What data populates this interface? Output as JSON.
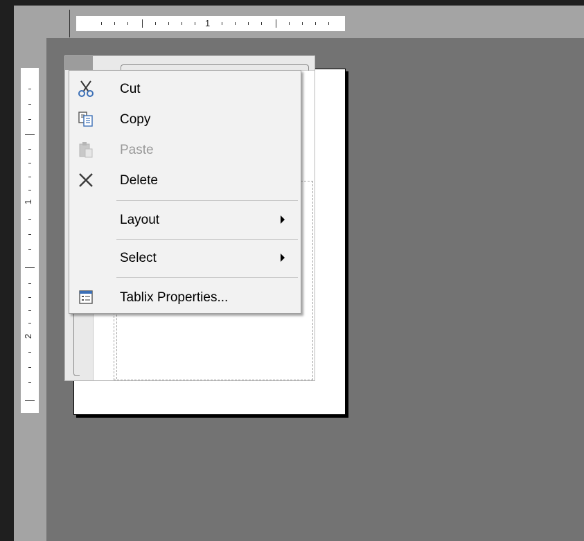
{
  "ruler": {
    "horizontal_number": "1",
    "vertical_numbers": [
      "1",
      "2"
    ]
  },
  "context_menu": {
    "items": [
      {
        "label": "Cut",
        "icon": "scissors-icon",
        "enabled": true
      },
      {
        "label": "Copy",
        "icon": "copy-icon",
        "enabled": true
      },
      {
        "label": "Paste",
        "icon": "paste-icon",
        "enabled": false
      },
      {
        "label": "Delete",
        "icon": "delete-x-icon",
        "enabled": true
      },
      {
        "label": "Layout",
        "icon": "",
        "enabled": true,
        "submenu": true
      },
      {
        "label": "Select",
        "icon": "",
        "enabled": true,
        "submenu": true
      },
      {
        "label": "Tablix Properties...",
        "icon": "properties-icon",
        "enabled": true
      }
    ]
  },
  "colors": {
    "canvas": "#737373",
    "menu_background": "#f2f2f2",
    "icon_blue": "#3b6fb6"
  }
}
